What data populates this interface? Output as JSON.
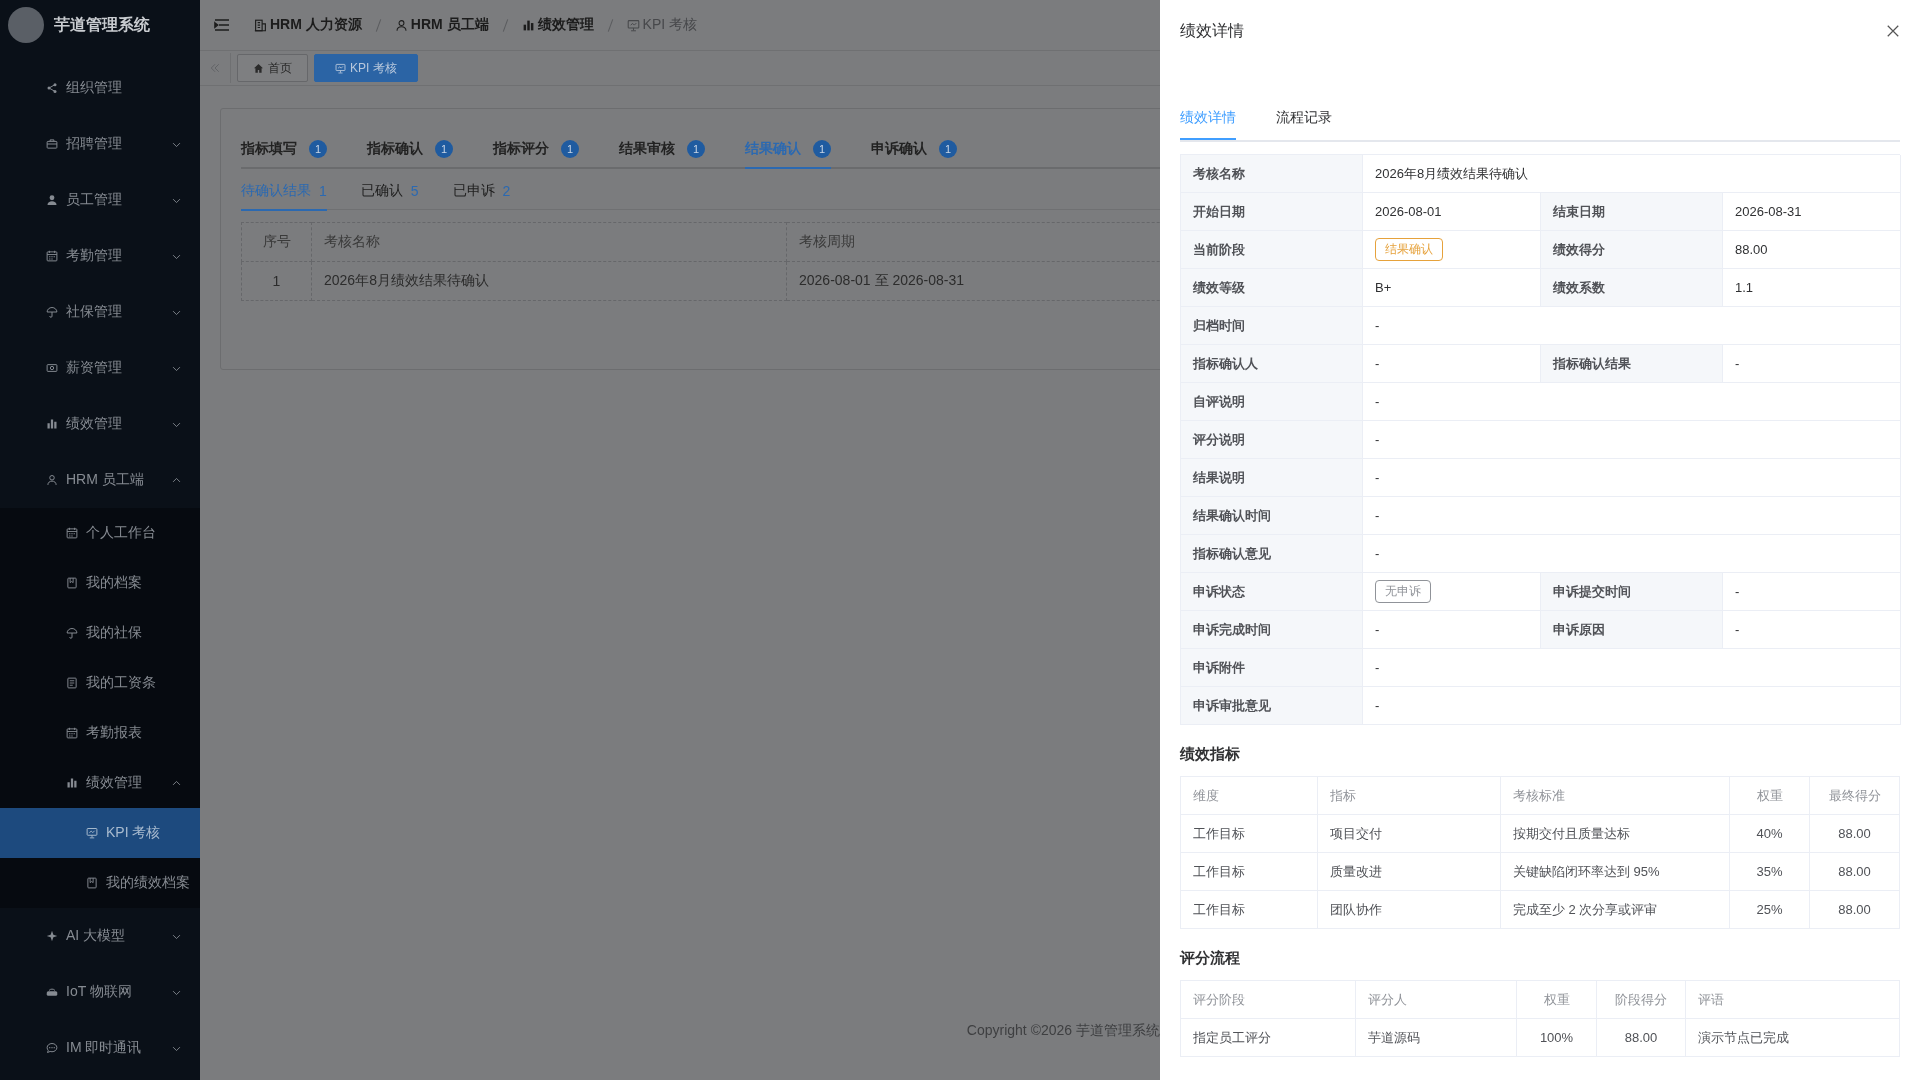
{
  "sidebar": {
    "title": "芋道管理系统",
    "items": [
      {
        "label": "组织管理",
        "selected": false
      },
      {
        "label": "招聘管理",
        "selected": false,
        "expanded": false
      },
      {
        "label": "员工管理",
        "selected": false,
        "expanded": false
      },
      {
        "label": "考勤管理",
        "selected": false,
        "expanded": false
      },
      {
        "label": "社保管理",
        "selected": false,
        "expanded": false
      },
      {
        "label": "薪资管理",
        "selected": false,
        "expanded": false
      },
      {
        "label": "绩效管理",
        "selected": false,
        "expanded": false
      },
      {
        "label": "HRM 员工端",
        "selected": false,
        "expanded": true,
        "children": [
          {
            "label": "个人工作台",
            "selected": false
          },
          {
            "label": "我的档案",
            "selected": false
          },
          {
            "label": "我的社保",
            "selected": false
          },
          {
            "label": "我的工资条",
            "selected": false
          },
          {
            "label": "考勤报表",
            "selected": false
          },
          {
            "label": "绩效管理",
            "selected": false,
            "expanded": true,
            "children": [
              {
                "label": "KPI 考核",
                "selected": true
              },
              {
                "label": "我的绩效档案",
                "selected": false
              }
            ]
          }
        ]
      },
      {
        "label": "AI 大模型",
        "selected": false,
        "expanded": false
      },
      {
        "label": "IoT 物联网",
        "selected": false,
        "expanded": false
      },
      {
        "label": "IM 即时通讯",
        "selected": false,
        "expanded": false
      }
    ]
  },
  "breadcrumb": [
    {
      "label": "HRM 人力资源",
      "current": false
    },
    {
      "label": "HRM 员工端",
      "current": false
    },
    {
      "label": "绩效管理",
      "current": false
    },
    {
      "label": "KPI 考核",
      "current": true
    }
  ],
  "page_tabs": [
    {
      "label": "首页",
      "selected": false
    },
    {
      "label": "KPI 考核",
      "selected": true
    }
  ],
  "stage_tabs": [
    {
      "label": "指标填写",
      "count": "1",
      "selected": false
    },
    {
      "label": "指标确认",
      "count": "1",
      "selected": false
    },
    {
      "label": "指标评分",
      "count": "1",
      "selected": false
    },
    {
      "label": "结果审核",
      "count": "1",
      "selected": false
    },
    {
      "label": "结果确认",
      "count": "1",
      "selected": true
    },
    {
      "label": "申诉确认",
      "count": "1",
      "selected": false
    }
  ],
  "status_tabs": [
    {
      "label": "待确认结果",
      "count": "1",
      "selected": true
    },
    {
      "label": "已确认",
      "count": "5",
      "selected": false
    },
    {
      "label": "已申诉",
      "count": "2",
      "selected": false
    }
  ],
  "table": {
    "columns": [
      "序号",
      "考核名称",
      "考核周期"
    ],
    "rows": [
      [
        "1",
        "2026年8月绩效结果待确认",
        "2026-08-01 至 2026-08-31"
      ]
    ]
  },
  "footer": "Copyright ©2026 芋道管理系统",
  "drawer": {
    "title": "绩效详情",
    "tabs": [
      {
        "label": "绩效详情",
        "selected": true
      },
      {
        "label": "流程记录",
        "selected": false
      }
    ],
    "details": [
      [
        {
          "label": "考核名称",
          "value": "2026年8月绩效结果待确认"
        }
      ],
      [
        {
          "label": "开始日期",
          "value": "2026-08-01"
        },
        {
          "label": "结束日期",
          "value": "2026-08-31"
        }
      ],
      [
        {
          "label": "当前阶段",
          "value": "结果确认",
          "kind": "tag",
          "color": "#e6a23c"
        },
        {
          "label": "绩效得分",
          "value": "88.00"
        }
      ],
      [
        {
          "label": "绩效等级",
          "value": "B+"
        },
        {
          "label": "绩效系数",
          "value": "1.1"
        }
      ],
      [
        {
          "label": "归档时间",
          "value": "-"
        }
      ],
      [
        {
          "label": "指标确认人",
          "value": "-"
        },
        {
          "label": "指标确认结果",
          "value": "-"
        }
      ],
      [
        {
          "label": "自评说明",
          "value": "-"
        }
      ],
      [
        {
          "label": "评分说明",
          "value": "-"
        }
      ],
      [
        {
          "label": "结果说明",
          "value": "-"
        }
      ],
      [
        {
          "label": "结果确认时间",
          "value": "-"
        }
      ],
      [
        {
          "label": "指标确认意见",
          "value": "-"
        }
      ],
      [
        {
          "label": "申诉状态",
          "value": "无申诉",
          "kind": "tag",
          "color": "#909399"
        },
        {
          "label": "申诉提交时间",
          "value": "-"
        }
      ],
      [
        {
          "label": "申诉完成时间",
          "value": "-"
        },
        {
          "label": "申诉原因",
          "value": "-"
        }
      ],
      [
        {
          "label": "申诉附件",
          "value": "-"
        }
      ],
      [
        {
          "label": "申诉审批意见",
          "value": "-"
        }
      ]
    ],
    "sections": [
      {
        "title": "绩效指标",
        "columns": [
          {
            "label": "维度"
          },
          {
            "label": "指标"
          },
          {
            "label": "考核标准"
          },
          {
            "label": "权重"
          },
          {
            "label": "最终得分"
          }
        ],
        "rows": [
          [
            "工作目标",
            "项目交付",
            "按期交付且质量达标",
            "40%",
            "88.00"
          ],
          [
            "工作目标",
            "质量改进",
            "关键缺陷闭环率达到 95%",
            "35%",
            "88.00"
          ],
          [
            "工作目标",
            "团队协作",
            "完成至少 2 次分享或评审",
            "25%",
            "88.00"
          ]
        ]
      },
      {
        "title": "评分流程",
        "columns": [
          {
            "label": "评分阶段"
          },
          {
            "label": "评分人"
          },
          {
            "label": "权重"
          },
          {
            "label": "阶段得分"
          },
          {
            "label": "评语"
          }
        ],
        "rows": [
          [
            "指定员工评分",
            "芋道源码",
            "100%",
            "88.00",
            "演示节点已完成"
          ]
        ]
      }
    ]
  }
}
